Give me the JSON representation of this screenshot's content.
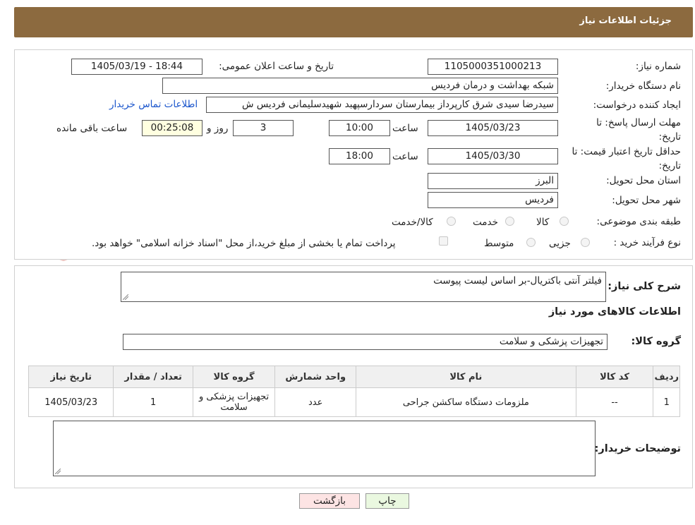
{
  "header": {
    "title": "جزئیات اطلاعات نیاز"
  },
  "form": {
    "need_number": {
      "label": "شماره نیاز:",
      "value": "1105000351000213"
    },
    "announce_datetime": {
      "label": "تاریخ و ساعت اعلان عمومی:",
      "value": "1405/03/19 - 18:44"
    },
    "buyer_org": {
      "label": "نام دستگاه خریدار:",
      "value": "شبکه بهداشت و درمان فردیس"
    },
    "requester": {
      "label": "ایجاد کننده درخواست:",
      "value": "سیدرضا سیدی شرق کارپرداز بیمارستان سردارسپهبد شهیدسلیمانی فردیس ش",
      "contact_link": "اطلاعات تماس خریدار"
    },
    "reply_deadline": {
      "label": "مهلت ارسال پاسخ: تا تاریخ:",
      "date": "1405/03/23",
      "time_label": "ساعت",
      "time": "10:00",
      "days": "3",
      "days_label": "روز و",
      "remaining": "00:25:08",
      "remaining_label": "ساعت باقی مانده"
    },
    "price_validity": {
      "label": "حداقل تاریخ اعتبار قیمت: تا تاریخ:",
      "date": "1405/03/30",
      "time_label": "ساعت",
      "time": "18:00"
    },
    "province": {
      "label": "استان محل تحویل:",
      "value": "البرز"
    },
    "city": {
      "label": "شهر محل تحویل:",
      "value": "فردیس"
    },
    "category": {
      "label": "طبقه بندی موضوعی:",
      "options": [
        "کالا",
        "خدمت",
        "کالا/خدمت"
      ]
    },
    "process_type": {
      "label": "نوع فرآیند خرید :",
      "options": [
        "جزیی",
        "متوسط"
      ],
      "payment_note": "پرداخت تمام یا بخشی از مبلغ خرید،از محل \"اسناد خزانه اسلامی\" خواهد بود."
    }
  },
  "details": {
    "summary_label": "شرح کلی نیاز:",
    "summary_value": "فیلتر آنتی باکتریال-بر اساس لیست پیوست",
    "goods_info_title": "اطلاعات کالاهای مورد نیاز",
    "group_label": "گروه کالا:",
    "group_value": "تجهیزات پزشکی و سلامت"
  },
  "table": {
    "headers": [
      "ردیف",
      "کد کالا",
      "نام کالا",
      "واحد شمارش",
      "گروه کالا",
      "تعداد / مقدار",
      "تاریخ نیاز"
    ],
    "rows": [
      [
        "1",
        "--",
        "ملزومات دستگاه ساکشن جراحی",
        "عدد",
        "تجهیزات پزشکی و سلامت",
        "1",
        "1405/03/23"
      ]
    ]
  },
  "buyer_notes": {
    "label": "توضیحات خریدار:",
    "value": ""
  },
  "buttons": {
    "print": "چاپ",
    "back": "بازگشت"
  },
  "colors": {
    "header_bg": "#8c6a3f",
    "print_btn": "#eaf8e0",
    "back_btn": "#fde4e4",
    "link": "#1a55cc"
  }
}
